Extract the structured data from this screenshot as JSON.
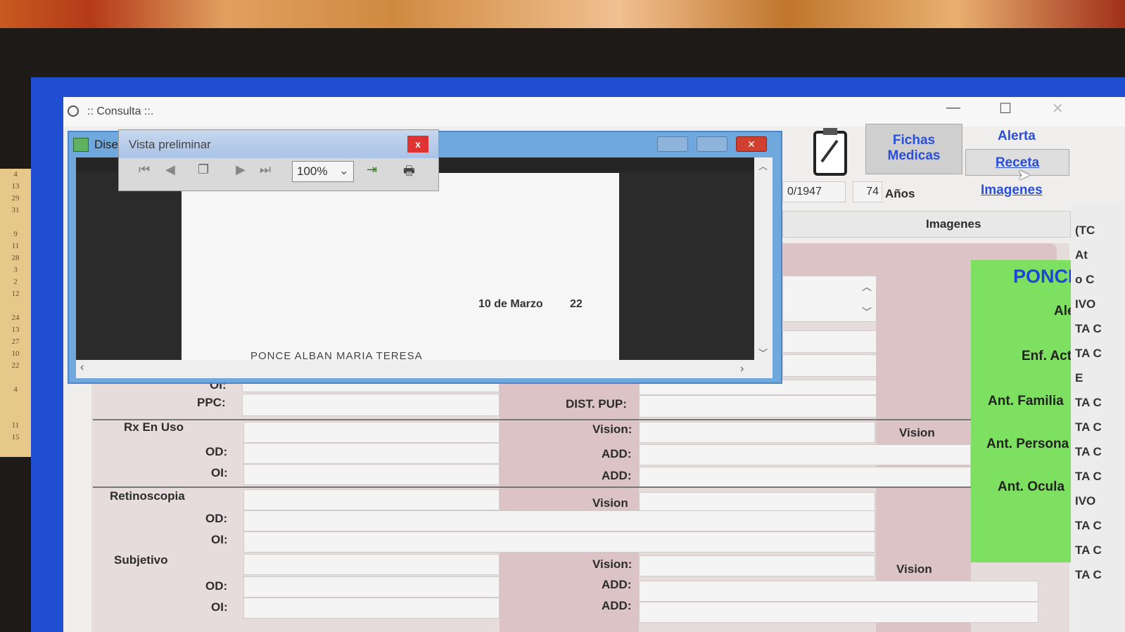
{
  "main_window": {
    "title": ":: Consulta ::.",
    "minimize": "—",
    "maximize": "☐",
    "close": "✕"
  },
  "designer_window": {
    "title": "Dise"
  },
  "preview": {
    "title": "Vista preliminar",
    "close": "x",
    "zoom": "100%",
    "page_date": "10 de Marzo",
    "page_day": "22",
    "page_name": "PONCE ALBAN MARIA TERESA"
  },
  "header": {
    "fichas_line1": "Fichas",
    "fichas_line2": "Medicas",
    "alerta": "Alerta",
    "receta": "Receta",
    "imagenes_link": "Imagenes",
    "birthdate": "0/1947",
    "age": "74",
    "age_unit": "Años",
    "imagenes_tab": "Imagenes"
  },
  "green_panel": {
    "name": "PONCE",
    "alergias": "Ale",
    "enf_act": "Enf. Act",
    "ant_familiares": "Ant. Familia",
    "ant_personales": "Ant. Persona",
    "ant_oculares": "Ant. Ocula"
  },
  "right_column": [
    "(TC",
    "At",
    "o C",
    "IVO",
    "TA C",
    "TA C",
    "E",
    "TA C",
    "TA C",
    "TA C",
    "TA C",
    "IVO",
    "TA C",
    "TA C",
    "TA C"
  ],
  "form": {
    "oi_partial": "OI:",
    "ppc": "PPC:",
    "dist_pup": "DIST. PUP:",
    "rx_en_uso": "Rx En Uso",
    "od": "OD:",
    "oi": "OI:",
    "vision_colon": "Vision:",
    "add": "ADD:",
    "vision": "Vision",
    "retinoscopia": "Retinoscopia",
    "subjetivo": "Subjetivo"
  },
  "calendar_strip": [
    "4",
    "13",
    "29",
    "31",
    "",
    "9",
    "11",
    "28",
    "3",
    "2",
    "12",
    "",
    "24",
    "13",
    "27",
    "10",
    "22",
    "",
    "4",
    "",
    "",
    "11",
    "15"
  ]
}
